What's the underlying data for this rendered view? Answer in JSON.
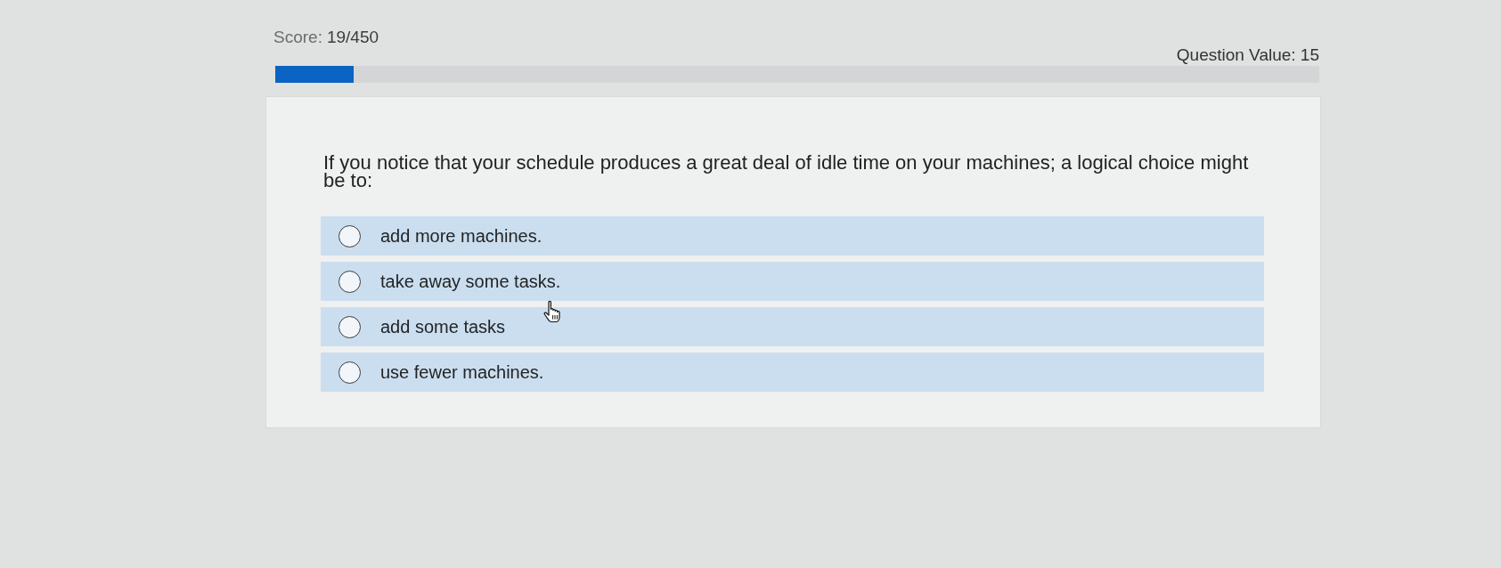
{
  "header": {
    "score_label": "Score:",
    "score_value": "19/450",
    "question_value": "Question Value: 15"
  },
  "progress": {
    "level": 0.075
  },
  "question": {
    "prompt": "If you notice that your schedule produces a great deal of idle time on your machines; a logical choice might be to:",
    "options": [
      {
        "label": "add more machines.",
        "selected": false
      },
      {
        "label": "take away some tasks.",
        "selected": false
      },
      {
        "label": "add some tasks",
        "selected": false
      },
      {
        "label": "use fewer machines.",
        "selected": false
      }
    ]
  }
}
